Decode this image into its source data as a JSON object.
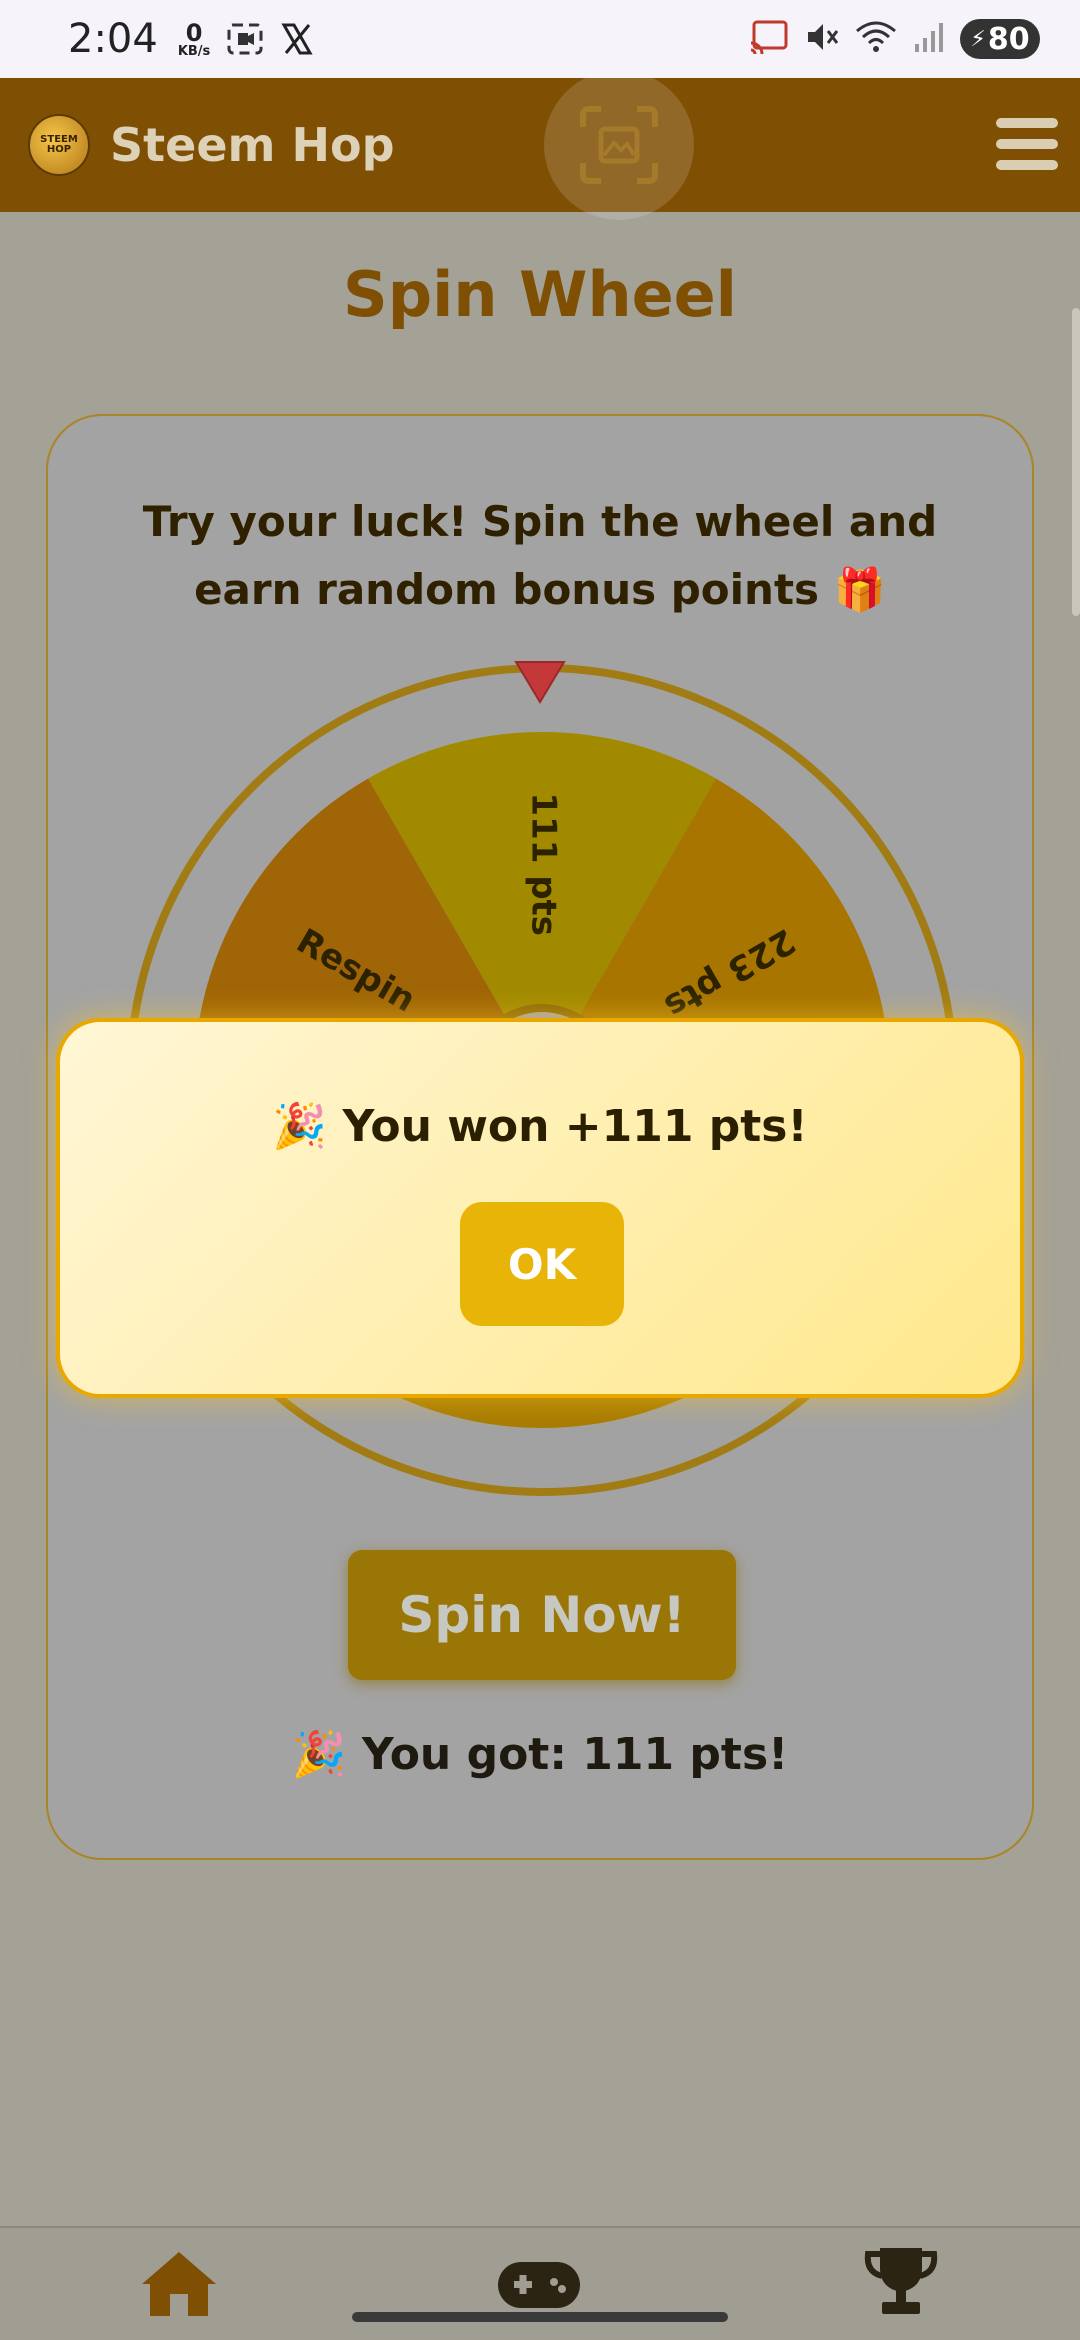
{
  "status_bar": {
    "time": "2:04",
    "net_speed_value": "0",
    "net_speed_unit": "KB/s",
    "battery_level": "80",
    "icons": [
      "screen-record-icon",
      "x-logo-icon",
      "cast-icon",
      "mute-icon",
      "wifi-icon",
      "signal-icon",
      "battery-icon"
    ]
  },
  "header": {
    "logo_text_line1": "STEEM",
    "logo_text_line2": "HOP",
    "app_title": "Steem Hop",
    "icons": [
      "image-search-icon",
      "menu-icon"
    ]
  },
  "page": {
    "title": "Spin Wheel",
    "description": "Try your luck! Spin the wheel and earn random bonus points 🎁"
  },
  "wheel": {
    "segments": [
      {
        "label": "111 pts",
        "color": "#a18a00"
      },
      {
        "label": "223 pts",
        "color": "#a77500"
      },
      {
        "label": "",
        "color": "#9c6a07"
      },
      {
        "label": "",
        "color": "#a77b00"
      },
      {
        "label": "",
        "color": "#a36a08"
      },
      {
        "label": "Respin",
        "color": "#9f6506"
      }
    ],
    "visible_labels": [
      "111 pts",
      "223 pts",
      "Respin"
    ],
    "pointer_color": "#c4383a",
    "rim_color": "#a17c14"
  },
  "spin_button": {
    "label": "Spin Now!"
  },
  "result": {
    "text": "🎉 You got: 111 pts!"
  },
  "popup": {
    "message": "🎉 You won +111 pts!",
    "ok_label": "OK"
  },
  "bottom_nav": {
    "items": [
      {
        "name": "home",
        "icon": "home-icon"
      },
      {
        "name": "games",
        "icon": "gamepad-icon"
      },
      {
        "name": "leaderboard",
        "icon": "trophy-icon"
      }
    ],
    "icon_color": "#7f5004"
  }
}
